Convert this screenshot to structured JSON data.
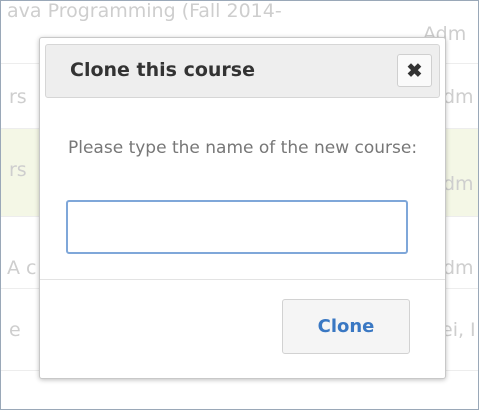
{
  "background": {
    "rows": [
      {
        "left_text": "ava Programming (Fall 2014-",
        "right_text": "Adm"
      },
      {
        "left_text": "rs",
        "right_text": "dm"
      },
      {
        "left_text": "rs",
        "right_text": "dm"
      },
      {
        "left_text": "A c",
        "right_text": "dm"
      },
      {
        "left_text": "e",
        "right_text": "ei, I"
      }
    ]
  },
  "dialog": {
    "title": "Clone this course",
    "close_icon": "close-x-icon",
    "prompt": "Please type the name of the new course:",
    "input_value": "",
    "input_placeholder": "",
    "clone_label": "Clone"
  },
  "colors": {
    "accent": "#3a78c3",
    "input_focus_border": "#7fa7d9",
    "highlight_row": "#f0f4dc"
  }
}
